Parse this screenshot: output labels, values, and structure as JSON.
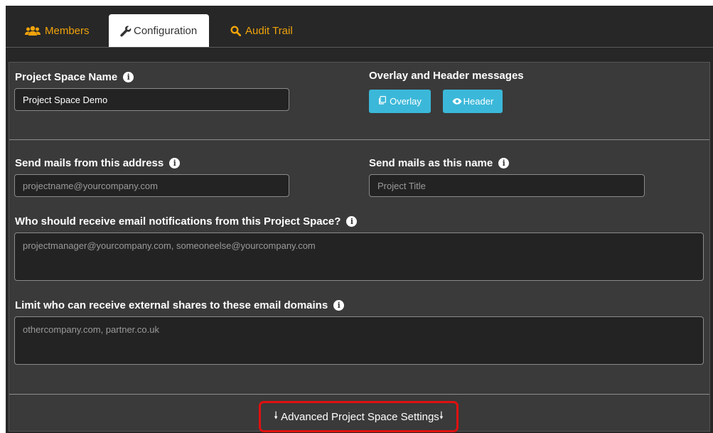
{
  "tabs": {
    "members": {
      "label": "Members",
      "icon": "users-icon"
    },
    "configuration": {
      "label": "Configuration",
      "icon": "wrench-icon"
    },
    "audit": {
      "label": "Audit Trail",
      "icon": "search-icon"
    }
  },
  "config": {
    "project_name_label": "Project Space Name",
    "project_name_value": "Project Space Demo",
    "overlay_header_label": "Overlay and Header messages",
    "overlay_button": "Overlay",
    "header_button": "Header",
    "send_from_label": "Send mails from this address",
    "send_from_placeholder": "projectname@yourcompany.com",
    "send_as_label": "Send mails as this name",
    "send_as_placeholder": "Project Title",
    "notify_label": "Who should receive email notifications from this Project Space?",
    "notify_placeholder": "projectmanager@yourcompany.com, someoneelse@yourcompany.com",
    "limit_label": "Limit who can receive external shares to these email domains",
    "limit_placeholder": "othercompany.com, partner.co.uk",
    "advanced_label": "Advanced Project Space Settings"
  },
  "colors": {
    "accent": "#f0a30a",
    "button": "#3bb8d9",
    "highlight": "#e01010"
  }
}
